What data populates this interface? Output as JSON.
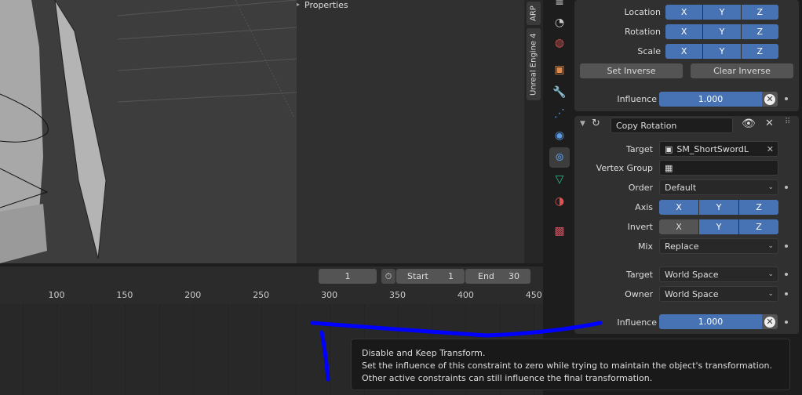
{
  "npanel": {
    "title": "Properties",
    "tabs": [
      "ARP",
      "Unreal Engine 4"
    ]
  },
  "timeline": {
    "current_frame": "1",
    "start_label": "Start",
    "start": "1",
    "end_label": "End",
    "end": "30",
    "ticks": [
      "100",
      "150",
      "200",
      "250",
      "300",
      "350",
      "400",
      "450"
    ]
  },
  "props_icons": [
    "scene-icon",
    "world-icon",
    "object-icon",
    "modifier-icon",
    "particles-icon",
    "physics-icon",
    "constraint-icon",
    "object-data-icon",
    "material-icon",
    "texture-icon"
  ],
  "child_of": {
    "location": "Location",
    "rotation": "Rotation",
    "scale": "Scale",
    "x": "X",
    "y": "Y",
    "z": "Z",
    "set_inverse": "Set Inverse",
    "clear_inverse": "Clear Inverse",
    "influence_label": "Influence",
    "influence": "1.000"
  },
  "copy_rotation": {
    "name": "Copy Rotation",
    "target_label": "Target",
    "target": "SM_ShortSwordL",
    "vertex_group_label": "Vertex Group",
    "order_label": "Order",
    "order": "Default",
    "axis_label": "Axis",
    "invert_label": "Invert",
    "axis": {
      "x": true,
      "y": true,
      "z": true
    },
    "invert": {
      "x": false,
      "y": true,
      "z": true
    },
    "mix_label": "Mix",
    "mix": "Replace",
    "target_space_label": "Target",
    "target_space": "World Space",
    "owner_space_label": "Owner",
    "owner_space": "World Space",
    "influence_label": "Influence",
    "influence": "1.000"
  },
  "tooltip": {
    "title": "Disable and Keep Transform.",
    "body": "Set the influence of this constraint to zero while trying to maintain the object's transformation. Other active constraints can still influence the final transformation."
  },
  "colors": {
    "accent": "#4772b3",
    "annotation": "#0000ff"
  }
}
